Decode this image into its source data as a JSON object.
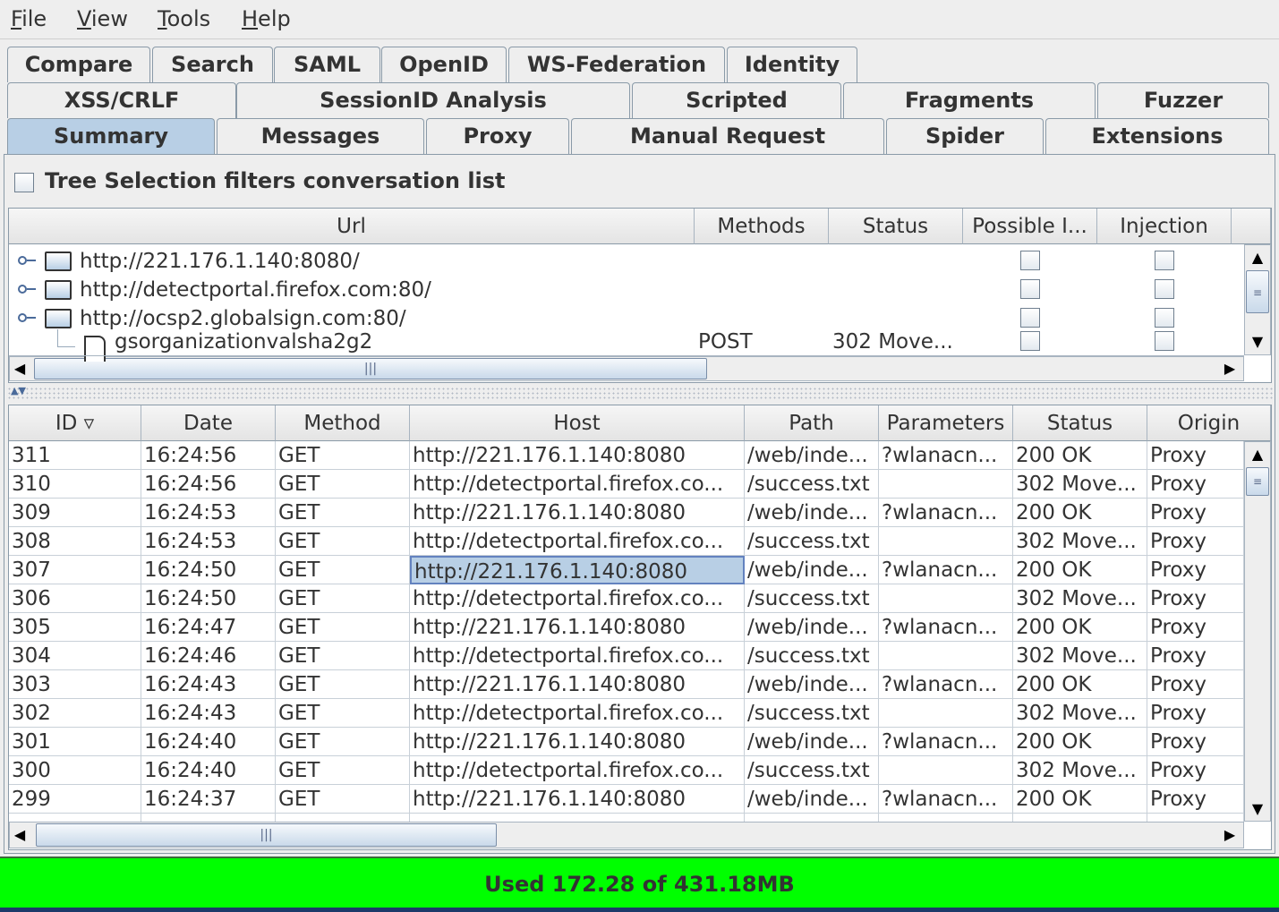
{
  "menu": [
    "File",
    "View",
    "Tools",
    "Help"
  ],
  "tabs_row1": [
    "Compare",
    "Search",
    "SAML",
    "OpenID",
    "WS-Federation",
    "Identity"
  ],
  "tabs_row2": [
    "XSS/CRLF",
    "SessionID Analysis",
    "Scripted",
    "Fragments",
    "Fuzzer"
  ],
  "tabs_row3": [
    "Summary",
    "Messages",
    "Proxy",
    "Manual Request",
    "Spider",
    "Extensions"
  ],
  "selected_tab": "Summary",
  "tree_filter_label": "Tree Selection filters conversation list",
  "tree_columns": [
    "Url",
    "Methods",
    "Status",
    "Possible I...",
    "Injection"
  ],
  "tree_rows": [
    {
      "url": "http://221.176.1.140:8080/",
      "type": "folder",
      "methods": "",
      "status": ""
    },
    {
      "url": "http://detectportal.firefox.com:80/",
      "type": "folder",
      "methods": "",
      "status": ""
    },
    {
      "url": "http://ocsp2.globalsign.com:80/",
      "type": "folder",
      "methods": "",
      "status": ""
    },
    {
      "url": "gsorganizationvalsha2g2",
      "type": "file",
      "methods": "POST",
      "status": "302 Move..."
    }
  ],
  "conv_columns": [
    "ID ▿",
    "Date",
    "Method",
    "Host",
    "Path",
    "Parameters",
    "Status",
    "Origin"
  ],
  "conversations": [
    [
      "311",
      "16:24:56",
      "GET",
      "http://221.176.1.140:8080",
      "/web/inde...",
      "?wlanacn...",
      "200 OK",
      "Proxy"
    ],
    [
      "310",
      "16:24:56",
      "GET",
      "http://detectportal.firefox.co...",
      "/success.txt",
      "",
      "302 Move...",
      "Proxy"
    ],
    [
      "309",
      "16:24:53",
      "GET",
      "http://221.176.1.140:8080",
      "/web/inde...",
      "?wlanacn...",
      "200 OK",
      "Proxy"
    ],
    [
      "308",
      "16:24:53",
      "GET",
      "http://detectportal.firefox.co...",
      "/success.txt",
      "",
      "302 Move...",
      "Proxy"
    ],
    [
      "307",
      "16:24:50",
      "GET",
      "http://221.176.1.140:8080",
      "/web/inde...",
      "?wlanacn...",
      "200 OK",
      "Proxy"
    ],
    [
      "306",
      "16:24:50",
      "GET",
      "http://detectportal.firefox.co...",
      "/success.txt",
      "",
      "302 Move...",
      "Proxy"
    ],
    [
      "305",
      "16:24:47",
      "GET",
      "http://221.176.1.140:8080",
      "/web/inde...",
      "?wlanacn...",
      "200 OK",
      "Proxy"
    ],
    [
      "304",
      "16:24:46",
      "GET",
      "http://detectportal.firefox.co...",
      "/success.txt",
      "",
      "302 Move...",
      "Proxy"
    ],
    [
      "303",
      "16:24:43",
      "GET",
      "http://221.176.1.140:8080",
      "/web/inde...",
      "?wlanacn...",
      "200 OK",
      "Proxy"
    ],
    [
      "302",
      "16:24:43",
      "GET",
      "http://detectportal.firefox.co...",
      "/success.txt",
      "",
      "302 Move...",
      "Proxy"
    ],
    [
      "301",
      "16:24:40",
      "GET",
      "http://221.176.1.140:8080",
      "/web/inde...",
      "?wlanacn...",
      "200 OK",
      "Proxy"
    ],
    [
      "300",
      "16:24:40",
      "GET",
      "http://detectportal.firefox.co...",
      "/success.txt",
      "",
      "302 Move...",
      "Proxy"
    ],
    [
      "299",
      "16:24:37",
      "GET",
      "http://221.176.1.140:8080",
      "/web/inde...",
      "?wlanacn...",
      "200 OK",
      "Proxy"
    ]
  ],
  "focused_cell": {
    "row": 4,
    "col": 3
  },
  "memory_status": "Used 172.28 of 431.18MB",
  "colors": {
    "status_bg": "#00ff00",
    "selected_tab": "#b8cfe5"
  }
}
